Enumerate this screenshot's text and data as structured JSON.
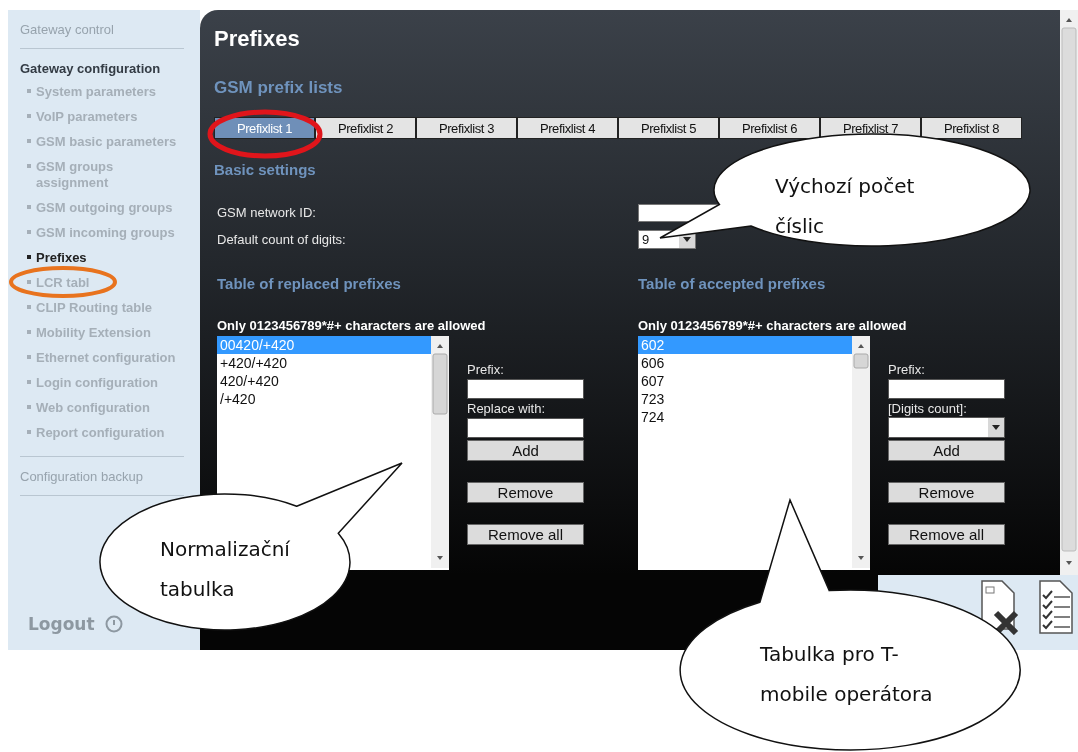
{
  "sidebar": {
    "sections": [
      {
        "label": "Gateway control",
        "selected": false
      },
      {
        "label": "Gateway configuration",
        "selected": true,
        "items": [
          {
            "label": "System parameters",
            "selected": false
          },
          {
            "label": "VoIP parameters",
            "selected": false
          },
          {
            "label": "GSM basic parameters",
            "selected": false
          },
          {
            "label": "GSM groups assignment",
            "selected": false
          },
          {
            "label": "GSM outgoing groups",
            "selected": false
          },
          {
            "label": "GSM incoming groups",
            "selected": false
          },
          {
            "label": "Prefixes",
            "selected": true
          },
          {
            "label": "LCR tabl",
            "selected": false
          },
          {
            "label": "CLIP Routing table",
            "selected": false
          },
          {
            "label": "Mobility Extension",
            "selected": false
          },
          {
            "label": "Ethernet configuration",
            "selected": false
          },
          {
            "label": "Login configuration",
            "selected": false
          },
          {
            "label": "Web configuration",
            "selected": false
          },
          {
            "label": "Report configuration",
            "selected": false
          }
        ]
      },
      {
        "label": "Configuration backup",
        "selected": false
      }
    ],
    "logout": "Logout"
  },
  "main": {
    "title": "Prefixes",
    "subtitle": "GSM prefix lists",
    "tabs": [
      {
        "label": "Prefixlist 1",
        "selected": true
      },
      {
        "label": "Prefixlist 2",
        "selected": false
      },
      {
        "label": "Prefixlist 3",
        "selected": false
      },
      {
        "label": "Prefixlist 4",
        "selected": false
      },
      {
        "label": "Prefixlist 5",
        "selected": false
      },
      {
        "label": "Prefixlist 6",
        "selected": false
      },
      {
        "label": "Prefixlist 7",
        "selected": false
      },
      {
        "label": "Prefixlist 8",
        "selected": false
      }
    ],
    "basic_settings": {
      "heading": "Basic settings",
      "fields": [
        {
          "label": "GSM network ID:",
          "kind": "input"
        },
        {
          "label": "Default count of digits:",
          "kind": "select",
          "value": "9"
        }
      ]
    },
    "tables": [
      {
        "heading": "Table of replaced prefixes",
        "note": "Only 0123456789*#+ characters are allowed",
        "rows": [
          {
            "text": "00420/+420",
            "selected": true
          },
          {
            "text": "+420/+420",
            "selected": false
          },
          {
            "text": "420/+420",
            "selected": false
          },
          {
            "text": "/+420",
            "selected": false
          }
        ],
        "fields": [
          {
            "label": "Prefix:",
            "kind": "input"
          },
          {
            "label": "Replace with:",
            "kind": "input"
          }
        ],
        "buttons": [
          "Add",
          "Remove",
          "Remove all"
        ]
      },
      {
        "heading": "Table of accepted prefixes",
        "note": "Only 0123456789*#+ characters are allowed",
        "rows": [
          {
            "text": "602",
            "selected": true
          },
          {
            "text": "606",
            "selected": false
          },
          {
            "text": "607",
            "selected": false
          },
          {
            "text": "723",
            "selected": false
          },
          {
            "text": "724",
            "selected": false
          }
        ],
        "fields": [
          {
            "label": "Prefix:",
            "kind": "input"
          },
          {
            "label": "[Digits count]:",
            "kind": "select"
          }
        ],
        "buttons": [
          "Add",
          "Remove",
          "Remove all"
        ]
      }
    ]
  },
  "annotations": {
    "highlights": [
      {
        "color": "#e0151b"
      },
      {
        "color": "#e8731e"
      }
    ],
    "callouts": [
      {
        "lines": [
          "Výchozí počet",
          "číslic"
        ]
      },
      {
        "lines": [
          "Normalizační",
          "tabulka"
        ]
      },
      {
        "lines": [
          "Tabulka pro T-",
          "mobile operátora"
        ]
      }
    ]
  }
}
